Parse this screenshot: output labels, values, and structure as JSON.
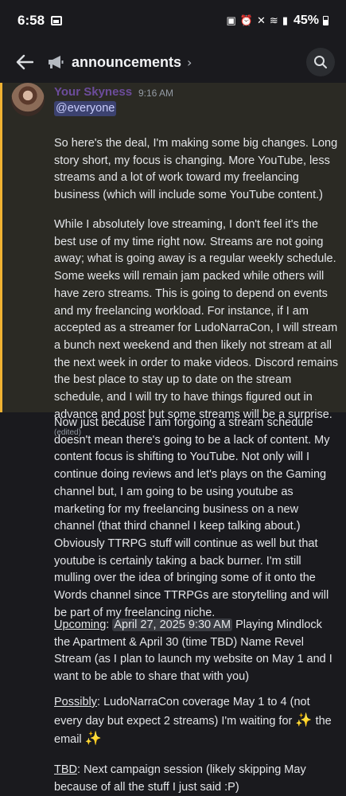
{
  "status_bar": {
    "time": "6:58",
    "battery": "45%"
  },
  "header": {
    "channel_name": "announcements",
    "chevron": "›"
  },
  "message": {
    "author": "Your Skyness",
    "timestamp": "9:16 AM",
    "mention": "@everyone",
    "paragraphs": {
      "p1": "So here's the deal, I'm making some big changes. Long story short, my focus is changing. More YouTube, less streams and a lot of work toward my freelancing business (which will include some YouTube content.)",
      "p2": "While I absolutely love streaming, I don't feel it's the best use of my time right now. Streams are not going away; what is going away is a regular weekly schedule. Some weeks will remain jam packed while others will have zero streams. This is going to depend on events and my freelancing workload. For instance, if I am accepted as a streamer for LudoNarraCon, I will stream a bunch next weekend and then likely not stream at all the next week in order to make videos. Discord remains the best place to stay up to date on the stream schedule, and I will try to have things figured out in advance and post but some streams will be a surprise.",
      "p2_edited": "(edited)",
      "p3": "Now just because I am forgoing a stream schedule doesn't mean there's going to be a lack of content. My content focus is shifting to YouTube. Not only will I continue doing reviews and let's plays on the Gaming channel but, I am going to be using youtube as marketing for my freelancing business on a new channel (that third channel I keep talking about.) Obviously TTRPG stuff will continue as well but that youtube is certainly taking a back burner. I'm still mulling over the idea of bringing some of it onto the Words channel since TTRPGs are storytelling and will be part of my freelancing niche.",
      "upcoming_label": "Upcoming",
      "upcoming_date": "April 27, 2025 9:30 AM",
      "upcoming_text": "Playing Mindlock the Apartment & April 30 (time TBD)  Name Revel Stream (as I plan to launch my website on May 1 and I want to be able to share that with you)",
      "possibly_label": "Possibly",
      "possibly_text": "LudoNarraCon coverage May 1 to 4 (not every day but expect 2 streams) I'm waiting for",
      "possibly_tail": "the email",
      "tbd_label": "TBD",
      "tbd_text": "Next campaign session (likely skipping May because of all the stuff I just said :P)"
    }
  },
  "colors": {
    "accent_highlight": "#f0b232",
    "author": "#6c4c9b",
    "mention_bg": "#3c4270"
  }
}
